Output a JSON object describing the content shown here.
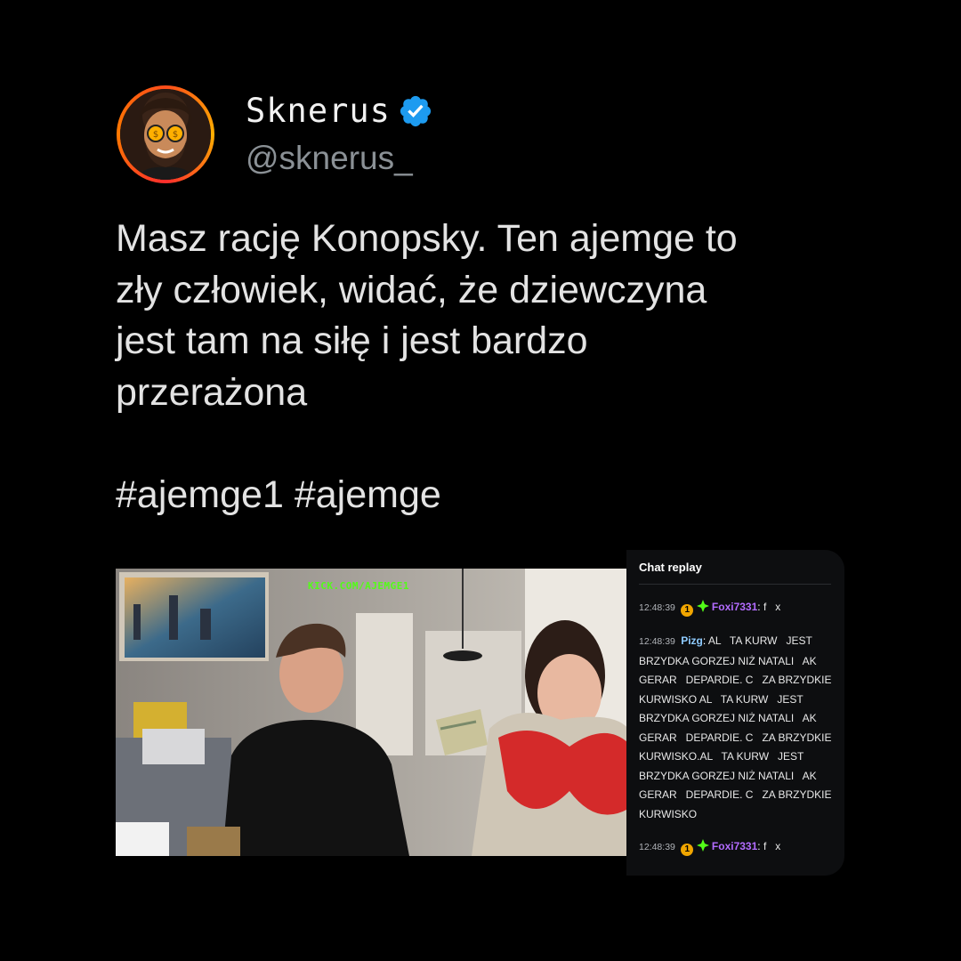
{
  "author": {
    "display_name": "Sknerus",
    "handle": "@sknerus_",
    "verified": true,
    "avatar_icon": "cartoon-avatar-with-coin-glasses",
    "accent": "#1d9bf0"
  },
  "tweet": {
    "lines": [
      "Masz rację Konopsky. Ten ajemge to",
      "zły człowiek, widać, że dziewczyna",
      "jest tam na siłę i jest bardzo",
      "przerażona"
    ],
    "hashtags": [
      "#ajemge1",
      "#ajemge"
    ]
  },
  "media": {
    "watermark": "KICK.COM/AJEMGE1"
  },
  "chat": {
    "header": "Chat replay",
    "messages": [
      {
        "time": "12:48:39",
        "badge": "1",
        "user": "Foxi7331",
        "text": "f   x"
      },
      {
        "time": "12:48:39",
        "user": "Pizg",
        "text": "AL   TA KURW   JEST BRZYDKA GORZEJ NIŻ NATALI   AK GERAR   DEPARDIE. C   ZA BRZYDKIE KURWISKO AL   TA KURW   JEST BRZYDKA GORZEJ NIŻ NATALI   AK GERAR   DEPARDIE. C   ZA BRZYDKIE KURWISKO.AL   TA KURW   JEST BRZYDKA GORZEJ NIŻ NATALI   AK GERAR   DEPARDIE. C   ZA BRZYDKIE KURWISKO"
      },
      {
        "time": "12:48:39",
        "badge": "1",
        "user": "Foxi7331",
        "text": "f   x"
      }
    ]
  }
}
